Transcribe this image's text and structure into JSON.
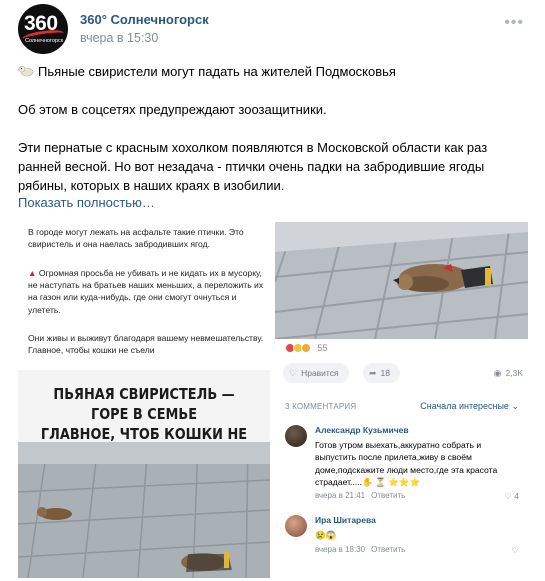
{
  "post": {
    "author": "360° Солнечногорск",
    "time": "вчера в 15:30",
    "avatar_text": "360",
    "avatar_subtext": "Солнечногорск",
    "paragraph1": "Пьяные свиристели могут падать на жителей Подмосковья",
    "paragraph2": "Об этом в соцсетях предупреждают зоозащитники.",
    "paragraph3": "Эти пернатые с красным хохолком появляются в Московской области как раз ранней весной. Но вот незадача - птички очень падки на забродившие ягоды рябины, которых в наших краях в изобилии.",
    "show_more": "Показать полностью…"
  },
  "image_text": {
    "para1": "В городе могут лежать на асфальте такие птички. Это свиристель и она наелась забродивших ягод.",
    "para2_marker": "▲",
    "para2": "Огромная просьба не убивать и не кидать их в мусорку, не наступать на братьев наших меньших, а переложить их на газон или куда-нибудь, где они смогут очнуться и улететь.",
    "para3": "Они живы и выживут благодаря вашему невмешательству. Главное, чтобы кошки не съели"
  },
  "poster": {
    "line1": "ПЬЯНАЯ СВИРИСТЕЛЬ — ГОРЕ В СЕМЬЕ",
    "line2": "ГЛАВНОЕ, ЧТОБ КОШКИ НЕ СЪЕЛИ"
  },
  "stats": {
    "reactions": "55",
    "like_label": "Нравится",
    "shares": "18",
    "views": "2,3K"
  },
  "comments_header": {
    "count_label": "3 КОММЕНТАРИЯ",
    "sort_label": "Сначала интересные"
  },
  "comments": [
    {
      "name": "Александр Кузьмичев",
      "text": "Готов утром выехать,аккуратно собрать и выпустить после прилета,живу в своём доме,подскажите люди место,где эта красота страдает.....✋ ⏳ ⭐⭐⭐",
      "time": "вчера в 21:41",
      "reply": "Ответить",
      "likes": "4"
    },
    {
      "name": "Ира Шитарева",
      "text": "😢😱",
      "time": "вчера в 18:30",
      "reply": "Ответить",
      "likes": ""
    }
  ],
  "colors": {
    "link": "#2a5885",
    "meta": "#818c99",
    "warning": "#d32727"
  }
}
